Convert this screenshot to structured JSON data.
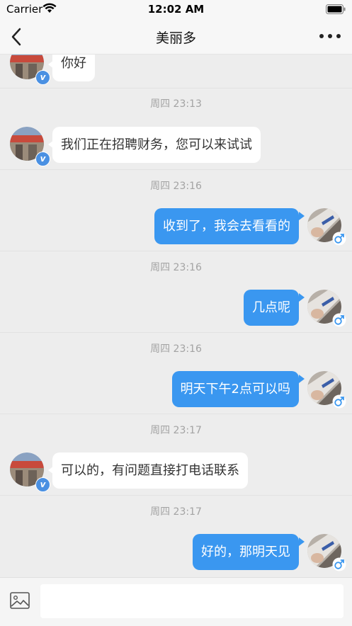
{
  "status_bar": {
    "carrier": "Carrier",
    "time": "12:02 AM"
  },
  "nav": {
    "title": "美丽多"
  },
  "messages": [
    {
      "type": "in",
      "text": "你好"
    },
    {
      "type": "time",
      "text": "周四 23:13"
    },
    {
      "type": "in",
      "text": "我们正在招聘财务，您可以来试试"
    },
    {
      "type": "time",
      "text": "周四 23:16"
    },
    {
      "type": "out",
      "text": "收到了，我会去看看的"
    },
    {
      "type": "time",
      "text": "周四 23:16"
    },
    {
      "type": "out",
      "text": "几点呢"
    },
    {
      "type": "time",
      "text": "周四 23:16"
    },
    {
      "type": "out",
      "text": "明天下午2点可以吗"
    },
    {
      "type": "time",
      "text": "周四 23:17"
    },
    {
      "type": "in",
      "text": "可以的，有问题直接打电话联系"
    },
    {
      "type": "time",
      "text": "周四 23:17"
    },
    {
      "type": "out",
      "text": "好的，那明天见"
    }
  ],
  "badges": {
    "verified_label": "v"
  },
  "colors": {
    "outgoing_bubble": "#3a97f0",
    "incoming_bubble": "#ffffff",
    "background": "#ededed"
  },
  "input": {
    "value": "",
    "placeholder": ""
  }
}
